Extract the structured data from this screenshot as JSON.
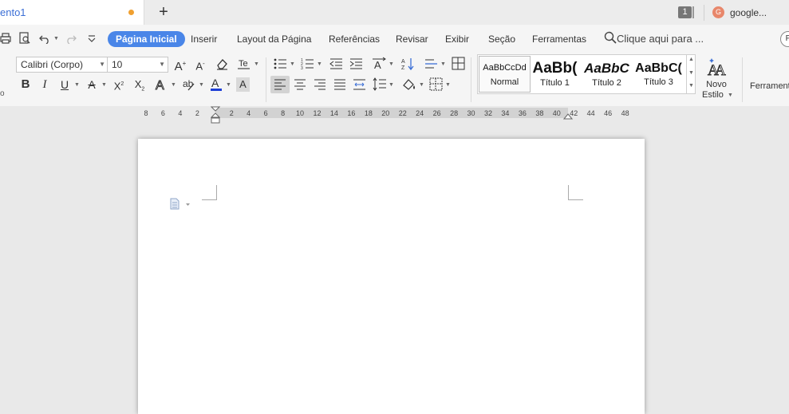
{
  "titlebar": {
    "doc_tab": "ento1",
    "new_tab": "+",
    "window_count": "1",
    "account_initial": "G",
    "account_name": "google..."
  },
  "menu": {
    "tabs": [
      "Página Inicial",
      "Inserir",
      "Layout da Página",
      "Referências",
      "Revisar",
      "Exibir",
      "Seção",
      "Ferramentas"
    ],
    "search_text": "Clique aqui para ...",
    "right_round": "P"
  },
  "ribbon": {
    "font_name": "Calibri (Corpo)",
    "font_size": "10",
    "styles": [
      {
        "sample": "AaBbCcDd",
        "label": "Normal"
      },
      {
        "sample": "AaBb(",
        "label": "Título 1"
      },
      {
        "sample": "AaBbC",
        "label": "Título 2"
      },
      {
        "sample": "AaBbC(",
        "label": "Título 3"
      }
    ],
    "new_style_line1": "Novo",
    "new_style_line2": "Estilo",
    "tools_cut": "Ferrament"
  },
  "ruler": {
    "labels": [
      "8",
      "6",
      "4",
      "2",
      "",
      "2",
      "4",
      "6",
      "8",
      "10",
      "12",
      "14",
      "16",
      "18",
      "20",
      "22",
      "24",
      "26",
      "28",
      "30",
      "32",
      "34",
      "36",
      "38",
      "40",
      "42",
      "44",
      "46",
      "48"
    ]
  },
  "colors": {
    "accent": "#4a86e8",
    "tab_text": "#3b6fd6",
    "unsaved_dot": "#f0a030",
    "avatar": "#e8876b",
    "font_color_bar": "#1f3fd6"
  }
}
